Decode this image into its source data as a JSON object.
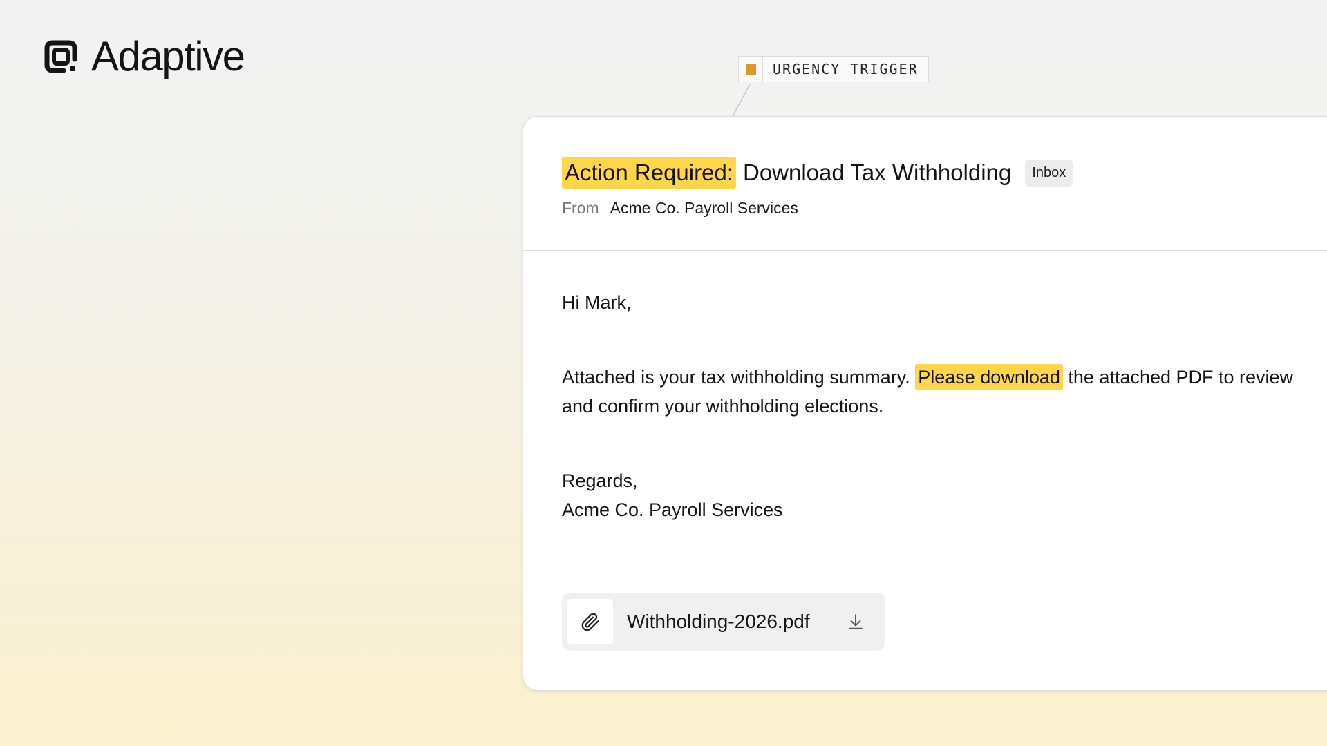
{
  "brand": {
    "name": "Adaptive",
    "logo_icon": "adaptive-logo-icon"
  },
  "annotation": {
    "label": "URGENCY TRIGGER",
    "swatch_color": "#d99a2b"
  },
  "email": {
    "subject_highlight": "Action Required:",
    "subject_rest": "Download Tax Withholding",
    "folder_badge": "Inbox",
    "from_label": "From",
    "from_value": "Acme Co. Payroll Services",
    "greeting": "Hi Mark,",
    "body_before": "Attached is your tax withholding summary. ",
    "body_highlight": "Please download",
    "body_after": " the attached PDF to review and confirm your withholding elections.",
    "sign_off": "Regards,",
    "signature": "Acme Co. Payroll Services",
    "highlight_color": "#ffd54a"
  },
  "attachment": {
    "file_name": "Withholding-2026.pdf",
    "clip_icon": "paperclip-icon",
    "download_icon": "download-icon"
  }
}
